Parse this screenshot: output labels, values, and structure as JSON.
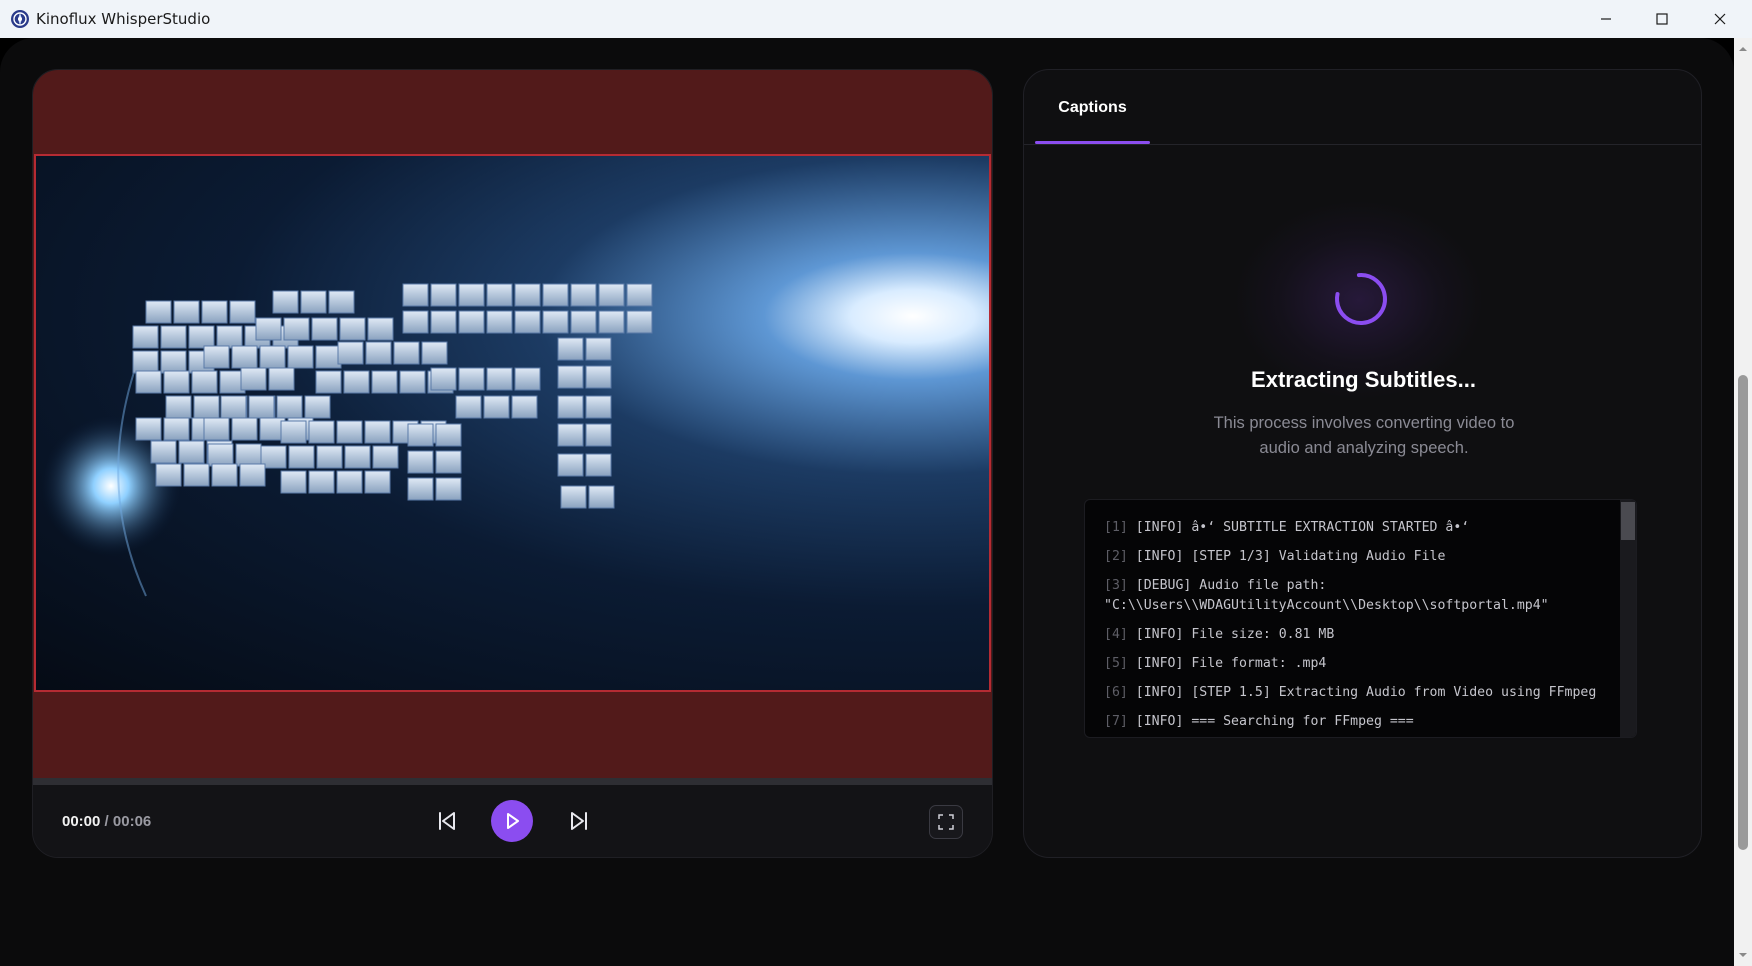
{
  "window": {
    "title": "Kinoflux WhisperStudio"
  },
  "player": {
    "current_time": "00:00",
    "separator": "/",
    "duration": "00:06",
    "progress": 0
  },
  "captions": {
    "tab_label": "Captions",
    "status_title": "Extracting Subtitles...",
    "status_description": "This process involves converting video to audio and analyzing speech.",
    "log": [
      {
        "num": "[1]",
        "text": "[INFO] â•‘ SUBTITLE EXTRACTION STARTED â•‘"
      },
      {
        "num": "[2]",
        "text": "[INFO] [STEP 1/3] Validating Audio File"
      },
      {
        "num": "[3]",
        "text": "[DEBUG] Audio file path: \"C:\\\\Users\\\\WDAGUtilityAccount\\\\Desktop\\\\softportal.mp4\""
      },
      {
        "num": "[4]",
        "text": "[INFO] File size: 0.81 MB"
      },
      {
        "num": "[5]",
        "text": "[INFO] File format: .mp4"
      },
      {
        "num": "[6]",
        "text": "[INFO] [STEP 1.5] Extracting Audio from Video using FFmpeg"
      },
      {
        "num": "[7]",
        "text": "[INFO] === Searching for FFmpeg ==="
      }
    ]
  },
  "colors": {
    "accent": "#8b4df0",
    "video_letterbox": "#521a1a",
    "video_border": "#b52b33"
  },
  "icons": {
    "app": "kinoflux-logo-icon",
    "minimize": "minimize-icon",
    "maximize": "maximize-icon",
    "close": "close-icon",
    "prev": "skip-back-icon",
    "play": "play-icon",
    "next": "skip-forward-icon",
    "fullscreen": "fullscreen-icon",
    "spinner": "loading-spinner-icon"
  }
}
